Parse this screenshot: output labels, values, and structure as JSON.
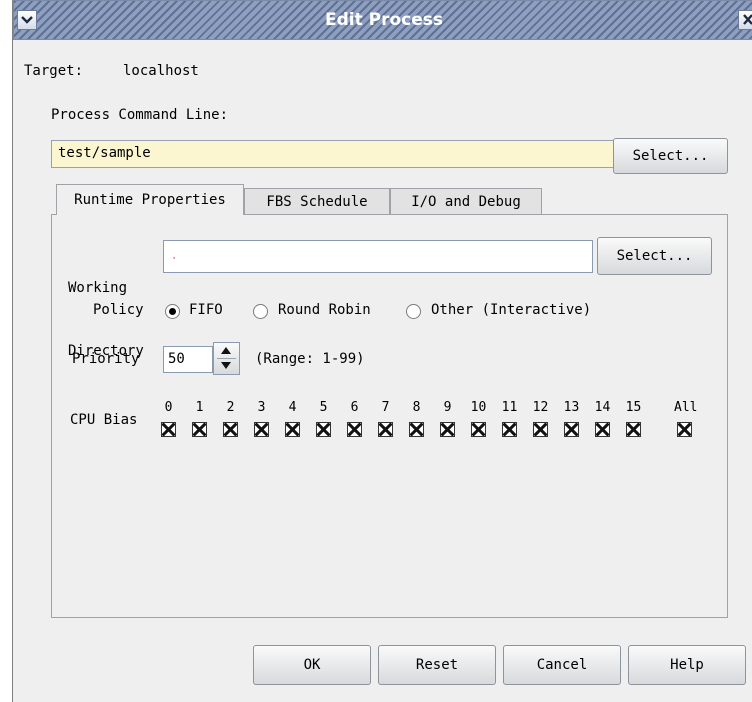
{
  "window": {
    "title": "Edit Process"
  },
  "target": {
    "label": "Target:",
    "value": "localhost"
  },
  "command": {
    "label": "Process Command Line:",
    "value": "test/sample",
    "select_label": "Select..."
  },
  "tabs": [
    {
      "label": "Runtime Properties"
    },
    {
      "label": "FBS Schedule"
    },
    {
      "label": "I/O and Debug"
    }
  ],
  "runtime": {
    "working_directory": {
      "label_line1": "Working",
      "label_line2": "Directory",
      "value": ".",
      "select_label": "Select..."
    },
    "policy": {
      "label": "Policy",
      "options": [
        "FIFO",
        "Round Robin",
        "Other (Interactive)"
      ],
      "selected": "FIFO"
    },
    "priority": {
      "label": "Priority",
      "value": "50",
      "range_text": "(Range: 1-99)"
    },
    "cpu_bias": {
      "label": "CPU Bias",
      "cpus": [
        "0",
        "1",
        "2",
        "3",
        "4",
        "5",
        "6",
        "7",
        "8",
        "9",
        "10",
        "11",
        "12",
        "13",
        "14",
        "15"
      ],
      "all_label": "All"
    }
  },
  "buttons": {
    "ok": "OK",
    "reset": "Reset",
    "cancel": "Cancel",
    "help": "Help"
  },
  "colors": {
    "title_bar": "#5e7094",
    "command_field": "#fbf6d0",
    "dialog_bg": "#efefef"
  }
}
